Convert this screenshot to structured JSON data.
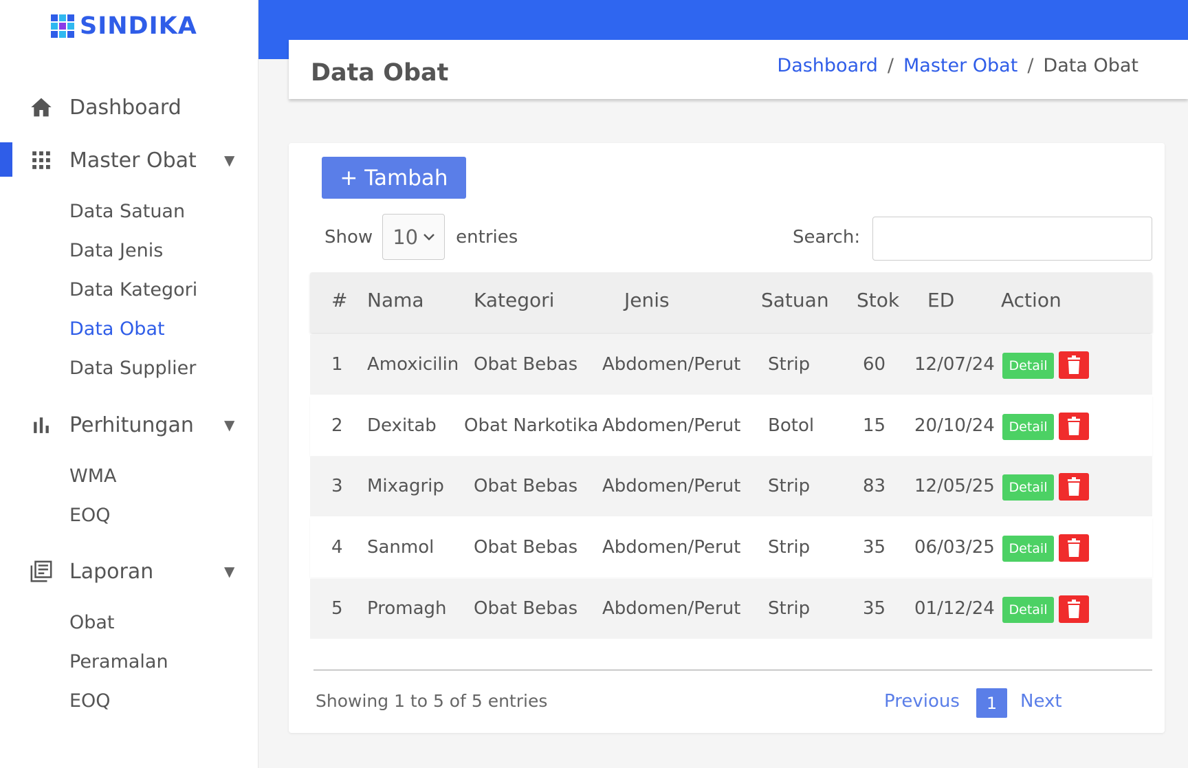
{
  "brand": {
    "name": "SINDIKA",
    "accent": "#2f5de8"
  },
  "sidebar": {
    "menu": [
      {
        "label": "Dashboard",
        "icon": "home-icon"
      },
      {
        "label": "Master Obat",
        "icon": "grid-icon",
        "caret": "▼",
        "children": [
          "Data Satuan",
          "Data Jenis",
          "Data Kategori",
          "Data Obat",
          "Data Supplier"
        ],
        "active_child": "Data Obat"
      },
      {
        "label": "Perhitungan",
        "icon": "bar-chart-icon",
        "caret": "▼",
        "children": [
          "WMA",
          "EOQ"
        ]
      },
      {
        "label": "Laporan",
        "icon": "report-icon",
        "caret": "▼",
        "children": [
          "Obat",
          "Peramalan",
          "EOQ"
        ]
      }
    ]
  },
  "header": {
    "title": "Data Obat",
    "breadcrumb": {
      "items": [
        "Dashboard",
        "Master Obat"
      ],
      "separator": "/",
      "current": "Data Obat"
    }
  },
  "toolbar": {
    "add_label": "+ Tambah",
    "show_label": "Show",
    "entries_value": "10",
    "entries_label": "entries",
    "search_label": "Search:",
    "search_value": ""
  },
  "table": {
    "columns": [
      "#",
      "Nama",
      "Kategori",
      "Jenis",
      "Satuan",
      "Stok",
      "ED",
      "Action"
    ],
    "rows": [
      {
        "no": "1",
        "nama": "Amoxicilin",
        "kategori": "Obat Bebas",
        "jenis": "Abdomen/Perut",
        "satuan": "Strip",
        "stok": "60",
        "ed": "12/07/24"
      },
      {
        "no": "2",
        "nama": "Dexitab",
        "kategori": "Obat Narkotika",
        "jenis": "Abdomen/Perut",
        "satuan": "Botol",
        "stok": "15",
        "ed": "20/10/24"
      },
      {
        "no": "3",
        "nama": "Mixagrip",
        "kategori": "Obat Bebas",
        "jenis": "Abdomen/Perut",
        "satuan": "Strip",
        "stok": "83",
        "ed": "12/05/25"
      },
      {
        "no": "4",
        "nama": "Sanmol",
        "kategori": "Obat Bebas",
        "jenis": "Abdomen/Perut",
        "satuan": "Strip",
        "stok": "35",
        "ed": "06/03/25"
      },
      {
        "no": "5",
        "nama": "Promagh",
        "kategori": "Obat Bebas",
        "jenis": "Abdomen/Perut",
        "satuan": "Strip",
        "stok": "35",
        "ed": "01/12/24"
      }
    ],
    "detail_label": "Detail"
  },
  "footer": {
    "info": "Showing 1 to 5 of 5 entries",
    "previous": "Previous",
    "page": "1",
    "next": "Next"
  }
}
